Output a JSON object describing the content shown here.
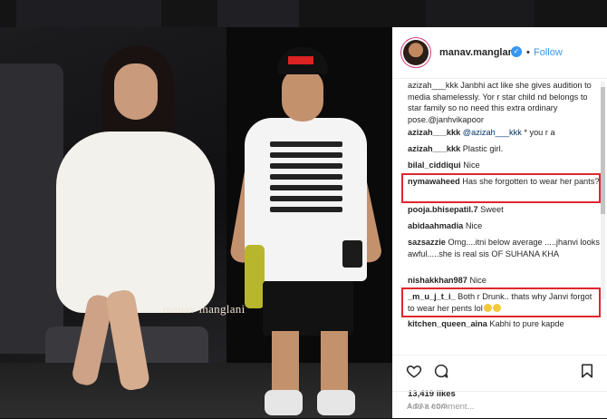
{
  "post": {
    "username": "manav.manglani",
    "follow_label": "Follow",
    "separator": "•",
    "verified_icon": "verified-badge-icon",
    "watermark": "manav manglani"
  },
  "comments": [
    {
      "text": "azizah___kkk Janbhi act like she gives audition to media shamelessly. Yor r star child nd belongs to star family so no need this extra ordinary pose.@janhvikapoor"
    },
    {
      "user": "azizah___kkk",
      "mention": "@azizah___kkk",
      "text": " * you r a"
    },
    {
      "user": "azizah___kkk",
      "text": " Plastic girl."
    },
    {
      "user": "bilal_ciddiqui",
      "text": " Nice"
    },
    {
      "user": "nymawaheed",
      "text": " Has she forgotten to wear her pants?"
    },
    {
      "user": "pooja.bhisepatil.7",
      "text": " Sweet"
    },
    {
      "user": "abidaahmadia",
      "text": " Nice"
    },
    {
      "user": "sazsazzie",
      "text": " Omg....itni below average .....jhanvi looks awful.....she is real sis OF SUHANA KHA"
    },
    {
      "user": "nishakkhan987",
      "text": " Nice"
    },
    {
      "user": "_m_u_j_t_i_",
      "text": " Both r Drunk.. thats why Janvi forgot to wear her pents lol"
    },
    {
      "user": "kitchen_queen_aina",
      "text": " Kabhi to pure kapde"
    }
  ],
  "actions": {
    "like_icon": "heart-icon",
    "comment_icon": "comment-icon",
    "save_icon": "bookmark-icon",
    "likes": "13,419 likes",
    "time": "1 DAY AGO"
  },
  "add_comment": {
    "placeholder": "Add a comment..."
  },
  "colors": {
    "link_blue": "#3897f0",
    "highlight_red": "#e0262e",
    "text": "#262626"
  }
}
